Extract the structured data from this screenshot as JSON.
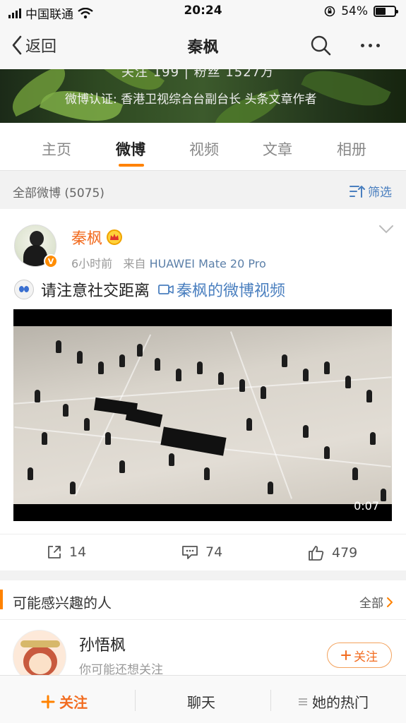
{
  "status_bar": {
    "carrier": "中国联通",
    "time": "20:24",
    "battery": "54%",
    "battery_level": 0.54
  },
  "nav": {
    "back_label": "返回",
    "title": "秦枫"
  },
  "cover": {
    "stats": "关注 199 | 粉丝 1527万",
    "verification": "微博认证: 香港卫视综合台副台长 头条文章作者"
  },
  "tabs": [
    {
      "label": "主页"
    },
    {
      "label": "微博"
    },
    {
      "label": "视频"
    },
    {
      "label": "文章"
    },
    {
      "label": "相册"
    }
  ],
  "active_tab": "微博",
  "filter": {
    "label": "全部微博 (5075)",
    "button": "筛选"
  },
  "post": {
    "author": "秦枫",
    "time": "6小时前",
    "source_prefix": "来自",
    "source": "HUAWEI Mate 20 Pro",
    "text": "请注意社交距离",
    "video_link": "秦枫的微博视频",
    "video_duration": "0:07",
    "reposts": "14",
    "comments": "74",
    "likes": "479"
  },
  "suggest": {
    "title": "可能感兴趣的人",
    "all_label": "全部",
    "user_name": "孙悟枫",
    "user_sub": "你可能还想关注",
    "follow_label": "关注"
  },
  "bottom_bar": {
    "follow": "关注",
    "chat": "聊天",
    "hot": "她的热门"
  },
  "colors": {
    "accent": "#ff8200",
    "link": "#4a7fbf",
    "name": "#f26c20"
  }
}
